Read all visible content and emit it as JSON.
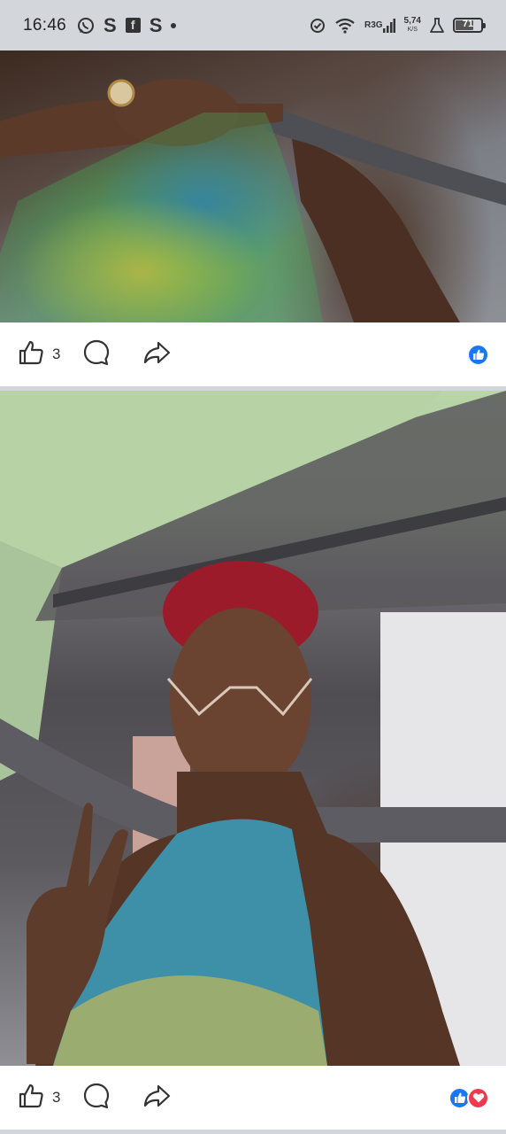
{
  "status_bar": {
    "time": "16:46",
    "left_icons": [
      "whatsapp-icon",
      "s-app-icon",
      "facebook-icon",
      "s-app-icon",
      "dot-icon"
    ],
    "s_letter": "S",
    "fb_letter": "f",
    "network_label": "R3G",
    "network_speed": "5,74",
    "network_unit": "K/S",
    "battery_level": "71",
    "colors": {
      "bar_bg": "#d3d6db",
      "icon": "#333333"
    }
  },
  "posts": [
    {
      "like_count": "3",
      "reactions": [
        "like"
      ]
    },
    {
      "like_count": "3",
      "reactions": [
        "like",
        "love"
      ]
    }
  ],
  "colors": {
    "like_blue": "#1877f2",
    "love_red": "#f0384f",
    "divider": "#d3d6db"
  }
}
